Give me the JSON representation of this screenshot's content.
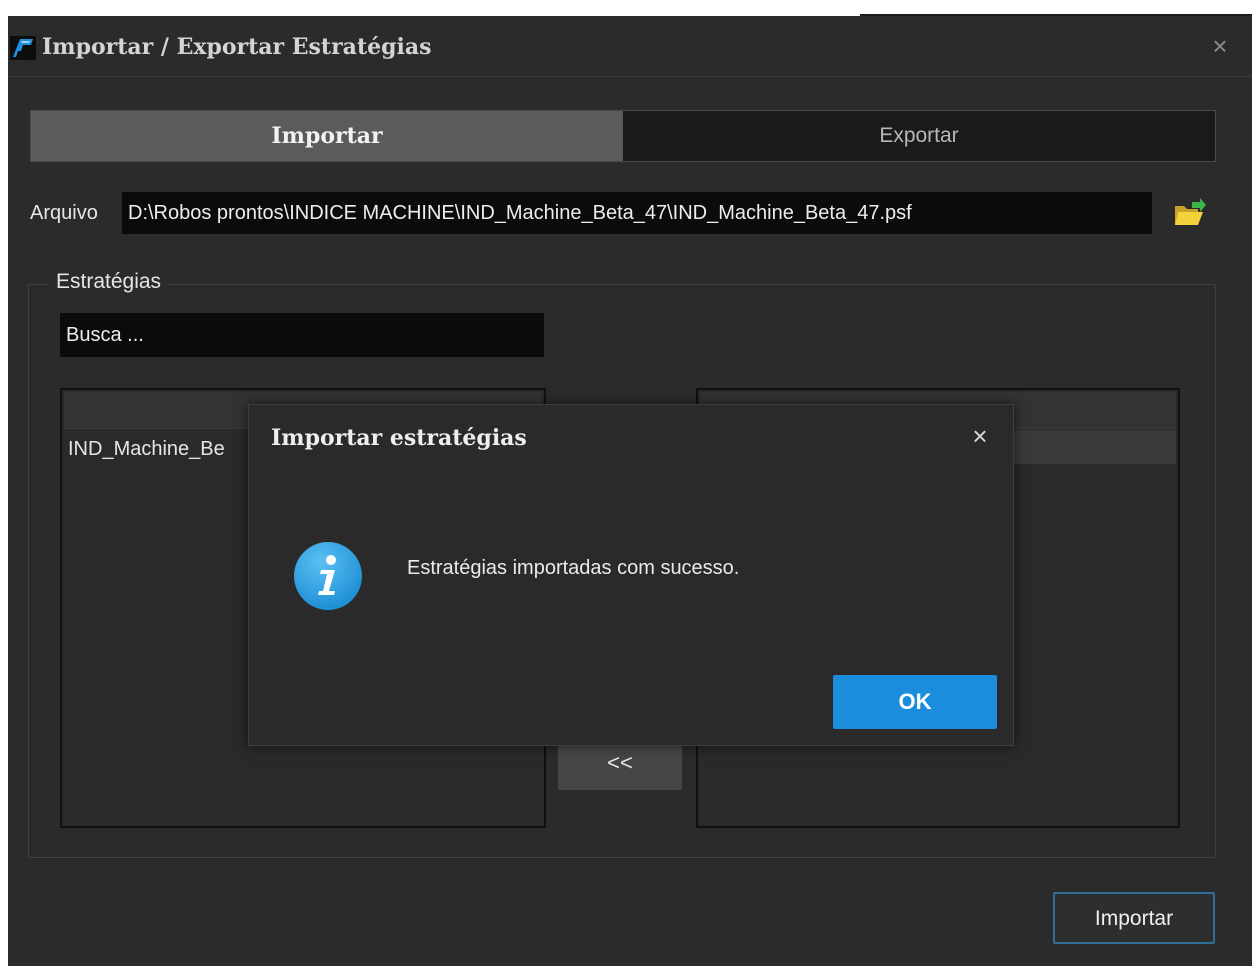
{
  "window": {
    "title": "Importar / Exportar Estratégias",
    "close_glyph": "×",
    "icon": "profit-app-icon"
  },
  "tabs": [
    {
      "label": "Importar",
      "active": true
    },
    {
      "label": "Exportar",
      "active": false
    }
  ],
  "file": {
    "label": "Arquivo",
    "value": "D:\\Robos prontos\\INDICE MACHINE\\IND_Machine_Beta_47\\IND_Machine_Beta_47.psf",
    "browse_icon": "folder-open-icon"
  },
  "strategies": {
    "group_label": "Estratégias",
    "search_value": "Busca ...",
    "left_list": [
      "IND_Machine_Be"
    ],
    "move_left_label": "<<"
  },
  "footer": {
    "import_label": "Importar"
  },
  "modal": {
    "title": "Importar estratégias",
    "close_glyph": "×",
    "icon": "info-icon",
    "message": "Estratégias importadas com sucesso.",
    "ok_label": "OK"
  },
  "colors": {
    "window_bg": "#2b2b2b",
    "active_tab": "#5b5b5b",
    "ok_button": "#1b8ddc",
    "info_icon": "#1e8fd6",
    "focus_border": "#2f6f9a"
  }
}
